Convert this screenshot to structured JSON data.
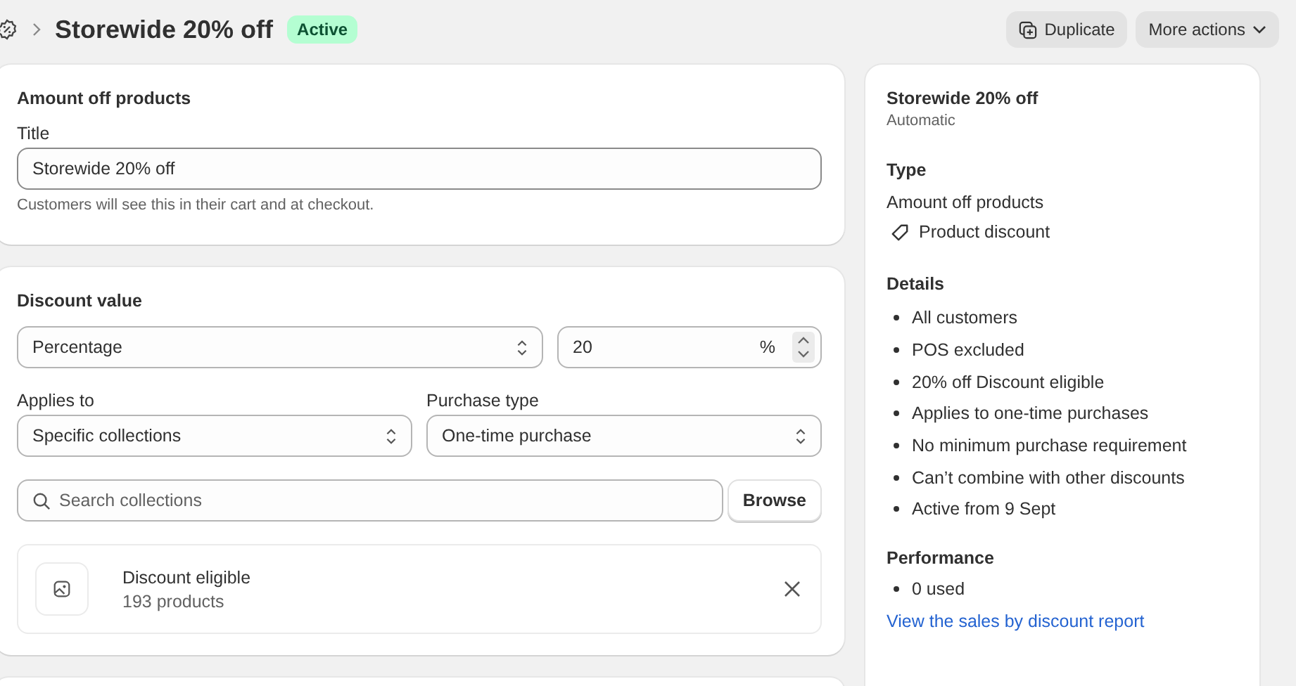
{
  "header": {
    "title": "Storewide 20% off",
    "status": "Active",
    "actions": [
      {
        "label": "Duplicate",
        "kind": "duplicate"
      },
      {
        "label": "More actions",
        "kind": "menu"
      }
    ]
  },
  "method_card": {
    "heading": "Amount off products",
    "title_label": "Title",
    "title_value": "Storewide 20% off",
    "help": "Customers will see this in their cart and at checkout."
  },
  "value_card": {
    "heading": "Discount value",
    "value_type": "Percentage",
    "amount": "20",
    "unit": "%",
    "applies_label": "Applies to",
    "applies_value": "Specific collections",
    "purchase_label": "Purchase type",
    "purchase_value": "One-time purchase",
    "search_placeholder": "Search collections",
    "browse": "Browse",
    "collections": [
      {
        "name": "Discount eligible",
        "count": "193 products"
      }
    ]
  },
  "summary": {
    "title": "Storewide 20% off",
    "subtitle": "Automatic",
    "type_heading": "Type",
    "type_value": "Amount off products",
    "type_tag": "Product discount",
    "details_heading": "Details",
    "details": [
      "All customers",
      "POS excluded",
      "20% off Discount eligible",
      "Applies to one-time purchases",
      "No minimum purchase requirement",
      "Can’t combine with other discounts",
      "Active from 9 Sept"
    ],
    "performance_heading": "Performance",
    "performance": [
      "0 used"
    ],
    "report_link": "View the sales by discount report"
  }
}
